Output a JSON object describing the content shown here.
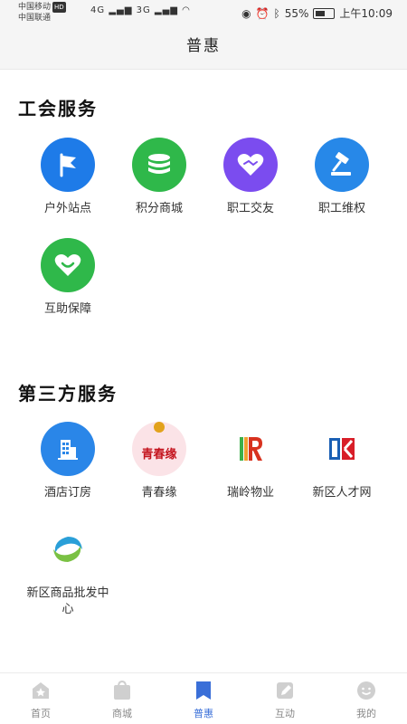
{
  "status": {
    "carrier1": "中国移动",
    "carrier2": "中国联通",
    "hd": "HD",
    "net1": "4G",
    "net2": "3G",
    "battery": "55%",
    "time": "上午10:09"
  },
  "header": {
    "title": "普惠"
  },
  "union_services": {
    "title": "工会服务",
    "items": [
      {
        "label": "户外站点",
        "icon": "flag-icon",
        "color": "#1e7be8"
      },
      {
        "label": "积分商城",
        "icon": "coins-icon",
        "color": "#2fb84a"
      },
      {
        "label": "职工交友",
        "icon": "heart-handshake-icon",
        "color": "#7b4cef"
      },
      {
        "label": "职工维权",
        "icon": "gavel-icon",
        "color": "#2788e8"
      },
      {
        "label": "互助保障",
        "icon": "smile-heart-icon",
        "color": "#2fb84a"
      }
    ]
  },
  "third_party": {
    "title": "第三方服务",
    "items": [
      {
        "label": "酒店订房",
        "icon": "building-icon",
        "color": "#2a86e8"
      },
      {
        "label": "青春缘",
        "icon": "qingchunyuan-logo",
        "logo_text": "青春缘"
      },
      {
        "label": "瑞岭物业",
        "icon": "ruiling-logo"
      },
      {
        "label": "新区人才网",
        "icon": "talent-logo"
      },
      {
        "label": "新区商品批发中心",
        "icon": "wholesale-logo"
      }
    ]
  },
  "tabbar": {
    "items": [
      {
        "label": "首页",
        "icon": "home-icon"
      },
      {
        "label": "商城",
        "icon": "shop-bag-icon"
      },
      {
        "label": "普惠",
        "icon": "bookmark-icon",
        "active": true
      },
      {
        "label": "互动",
        "icon": "pencil-icon"
      },
      {
        "label": "我的",
        "icon": "profile-face-icon"
      }
    ]
  }
}
